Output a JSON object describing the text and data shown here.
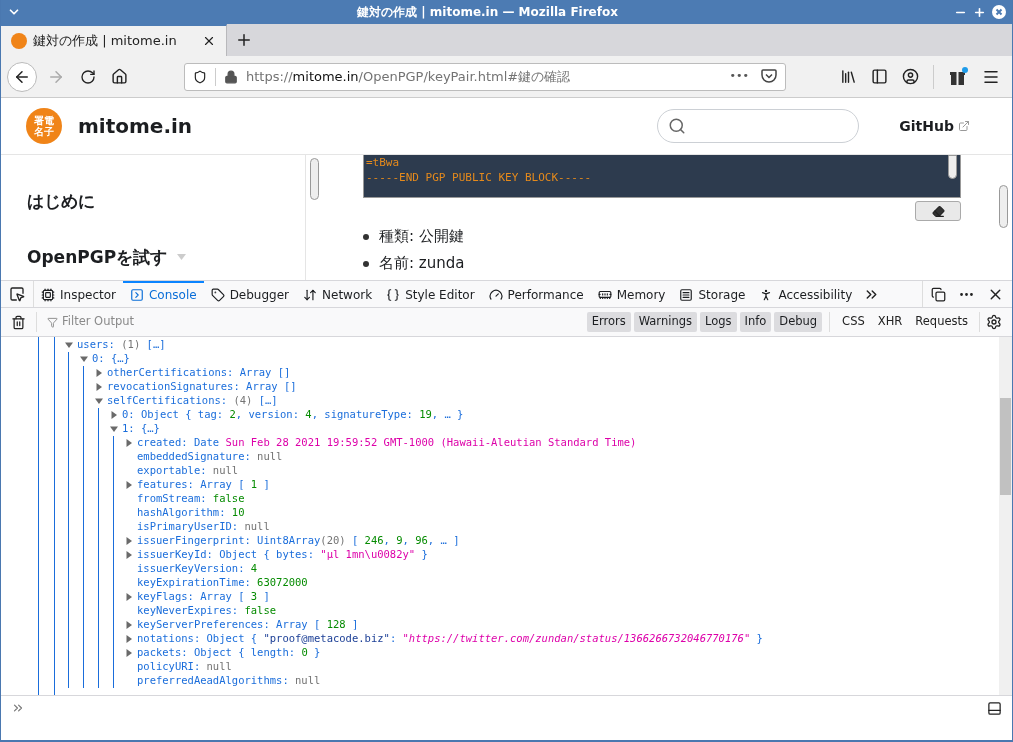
{
  "window": {
    "title": "鍵対の作成 | mitome.in — Mozilla Firefox"
  },
  "tabs": [
    {
      "label": "鍵対の作成 | mitome.in",
      "selected": true
    }
  ],
  "address_bar": {
    "scheme": "https://",
    "domain": "mitome.in",
    "path": "/OpenPGP/keyPair.html#鍵の確認",
    "more": "•••"
  },
  "site": {
    "logo_lines": [
      "署電",
      "名子"
    ],
    "name": "mitome.in",
    "github_link": "GitHub"
  },
  "sidebar": {
    "items": [
      {
        "label": "はじめに",
        "expandable": false
      },
      {
        "label": "OpenPGPを試す",
        "expandable": true
      }
    ]
  },
  "content": {
    "code_lines": [
      "=tBwa",
      "-----END PGP PUBLIC KEY BLOCK-----"
    ],
    "bullets": [
      "種類: 公開鍵",
      "名前: zunda"
    ]
  },
  "devtools": {
    "tabs": [
      {
        "label": "Inspector",
        "selected": false
      },
      {
        "label": "Console",
        "selected": true
      },
      {
        "label": "Debugger",
        "selected": false
      },
      {
        "label": "Network",
        "selected": false
      },
      {
        "label": "Style Editor",
        "selected": false
      },
      {
        "label": "Performance",
        "selected": false
      },
      {
        "label": "Memory",
        "selected": false
      },
      {
        "label": "Storage",
        "selected": false
      },
      {
        "label": "Accessibility",
        "selected": false
      }
    ],
    "filter": {
      "placeholder": "Filter Output"
    },
    "levels": [
      {
        "label": "Errors",
        "selected": true
      },
      {
        "label": "Warnings",
        "selected": true
      },
      {
        "label": "Logs",
        "selected": true
      },
      {
        "label": "Info",
        "selected": true
      },
      {
        "label": "Debug",
        "selected": true
      }
    ],
    "request_filters": [
      {
        "label": "CSS",
        "selected": false
      },
      {
        "label": "XHR",
        "selected": false
      },
      {
        "label": "Requests",
        "selected": false
      }
    ],
    "console": {
      "tree": [
        {
          "kind": "object",
          "expanded": true,
          "parts": [
            {
              "text": "users: ",
              "kind": "p"
            },
            {
              "text": "(1)",
              "kind": "x"
            },
            {
              "text": " […]",
              "kind": "p"
            }
          ],
          "children": [
            {
              "kind": "object",
              "expanded": true,
              "parts": [
                {
                  "text": "0: {…}",
                  "kind": "p"
                }
              ],
              "children": [
                {
                  "kind": "object",
                  "expanded": false,
                  "parts": [
                    {
                      "text": "otherCertifications: Array []",
                      "kind": "p"
                    }
                  ]
                },
                {
                  "kind": "object",
                  "expanded": false,
                  "parts": [
                    {
                      "text": "revocationSignatures: Array []",
                      "kind": "p"
                    }
                  ]
                },
                {
                  "kind": "object",
                  "expanded": true,
                  "parts": [
                    {
                      "text": "selfCertifications: ",
                      "kind": "p"
                    },
                    {
                      "text": "(4)",
                      "kind": "x"
                    },
                    {
                      "text": " […]",
                      "kind": "p"
                    }
                  ],
                  "children": [
                    {
                      "kind": "object",
                      "expanded": false,
                      "parts": [
                        {
                          "text": "0: Object { tag: ",
                          "kind": "p"
                        },
                        {
                          "text": "2",
                          "kind": "n"
                        },
                        {
                          "text": ", version: ",
                          "kind": "p"
                        },
                        {
                          "text": "4",
                          "kind": "n"
                        },
                        {
                          "text": ", signatureType: ",
                          "kind": "p"
                        },
                        {
                          "text": "19",
                          "kind": "n"
                        },
                        {
                          "text": ", … }",
                          "kind": "p"
                        }
                      ]
                    },
                    {
                      "kind": "object",
                      "expanded": true,
                      "parts": [
                        {
                          "text": "1: {…}",
                          "kind": "p"
                        }
                      ],
                      "children": [
                        {
                          "kind": "object",
                          "expanded": false,
                          "parts": [
                            {
                              "text": "created: Date ",
                              "kind": "p"
                            },
                            {
                              "text": "Sun Feb 28 2021 19:59:52 GMT-1000 (Hawaii-Aleutian Standard Time)",
                              "kind": "s"
                            }
                          ]
                        },
                        {
                          "kind": "value",
                          "parts": [
                            {
                              "text": "embeddedSignature: ",
                              "kind": "p"
                            },
                            {
                              "text": "null",
                              "kind": "x"
                            }
                          ]
                        },
                        {
                          "kind": "value",
                          "parts": [
                            {
                              "text": "exportable: ",
                              "kind": "p"
                            },
                            {
                              "text": "null",
                              "kind": "x"
                            }
                          ]
                        },
                        {
                          "kind": "object",
                          "expanded": false,
                          "parts": [
                            {
                              "text": "features: Array [ ",
                              "kind": "p"
                            },
                            {
                              "text": "1",
                              "kind": "n"
                            },
                            {
                              "text": " ]",
                              "kind": "p"
                            }
                          ]
                        },
                        {
                          "kind": "value",
                          "parts": [
                            {
                              "text": "fromStream: ",
                              "kind": "p"
                            },
                            {
                              "text": "false",
                              "kind": "n"
                            }
                          ]
                        },
                        {
                          "kind": "value",
                          "parts": [
                            {
                              "text": "hashAlgorithm: ",
                              "kind": "p"
                            },
                            {
                              "text": "10",
                              "kind": "n"
                            }
                          ]
                        },
                        {
                          "kind": "value",
                          "parts": [
                            {
                              "text": "isPrimaryUserID: ",
                              "kind": "p"
                            },
                            {
                              "text": "null",
                              "kind": "x"
                            }
                          ]
                        },
                        {
                          "kind": "object",
                          "expanded": false,
                          "parts": [
                            {
                              "text": "issuerFingerprint: Uint8Array",
                              "kind": "p"
                            },
                            {
                              "text": "(20)",
                              "kind": "x"
                            },
                            {
                              "text": " [ ",
                              "kind": "p"
                            },
                            {
                              "text": "246",
                              "kind": "n"
                            },
                            {
                              "text": ", ",
                              "kind": "p"
                            },
                            {
                              "text": "9",
                              "kind": "n"
                            },
                            {
                              "text": ", ",
                              "kind": "p"
                            },
                            {
                              "text": "96",
                              "kind": "n"
                            },
                            {
                              "text": ", … ]",
                              "kind": "p"
                            }
                          ]
                        },
                        {
                          "kind": "object",
                          "expanded": false,
                          "parts": [
                            {
                              "text": "issuerKeyId: Object { bytes: ",
                              "kind": "p"
                            },
                            {
                              "text": "\"µl 1mn\\u0082y\"",
                              "kind": "s"
                            },
                            {
                              "text": " }",
                              "kind": "p"
                            }
                          ]
                        },
                        {
                          "kind": "value",
                          "parts": [
                            {
                              "text": "issuerKeyVersion: ",
                              "kind": "p"
                            },
                            {
                              "text": "4",
                              "kind": "n"
                            }
                          ]
                        },
                        {
                          "kind": "value",
                          "parts": [
                            {
                              "text": "keyExpirationTime: ",
                              "kind": "p"
                            },
                            {
                              "text": "63072000",
                              "kind": "n"
                            }
                          ]
                        },
                        {
                          "kind": "object",
                          "expanded": false,
                          "parts": [
                            {
                              "text": "keyFlags: Array [ ",
                              "kind": "p"
                            },
                            {
                              "text": "3",
                              "kind": "n"
                            },
                            {
                              "text": " ]",
                              "kind": "p"
                            }
                          ]
                        },
                        {
                          "kind": "value",
                          "parts": [
                            {
                              "text": "keyNeverExpires: ",
                              "kind": "p"
                            },
                            {
                              "text": "false",
                              "kind": "n"
                            }
                          ]
                        },
                        {
                          "kind": "object",
                          "expanded": false,
                          "parts": [
                            {
                              "text": "keyServerPreferences: Array [ ",
                              "kind": "p"
                            },
                            {
                              "text": "128",
                              "kind": "n"
                            },
                            {
                              "text": " ]",
                              "kind": "p"
                            }
                          ]
                        },
                        {
                          "kind": "object",
                          "expanded": false,
                          "parts": [
                            {
                              "text": "notations: Object { ",
                              "kind": "p"
                            },
                            {
                              "text": "\"proof@metacode.biz\"",
                              "kind": "q"
                            },
                            {
                              "text": ": ",
                              "kind": "p"
                            },
                            {
                              "text": "\"https://twitter.com/zundan/status/1366266732046770176\"",
                              "kind": "si"
                            },
                            {
                              "text": " }",
                              "kind": "p"
                            }
                          ]
                        },
                        {
                          "kind": "object",
                          "expanded": false,
                          "parts": [
                            {
                              "text": "packets: Object { length: ",
                              "kind": "p"
                            },
                            {
                              "text": "0",
                              "kind": "n"
                            },
                            {
                              "text": " }",
                              "kind": "p"
                            }
                          ]
                        },
                        {
                          "kind": "value",
                          "parts": [
                            {
                              "text": "policyURI: ",
                              "kind": "p"
                            },
                            {
                              "text": "null",
                              "kind": "x"
                            }
                          ]
                        },
                        {
                          "kind": "value",
                          "parts": [
                            {
                              "text": "preferredAeadAlgorithms: ",
                              "kind": "p"
                            },
                            {
                              "text": "null",
                              "kind": "x"
                            }
                          ]
                        }
                      ]
                    }
                  ]
                }
              ]
            }
          ]
        }
      ]
    }
  }
}
